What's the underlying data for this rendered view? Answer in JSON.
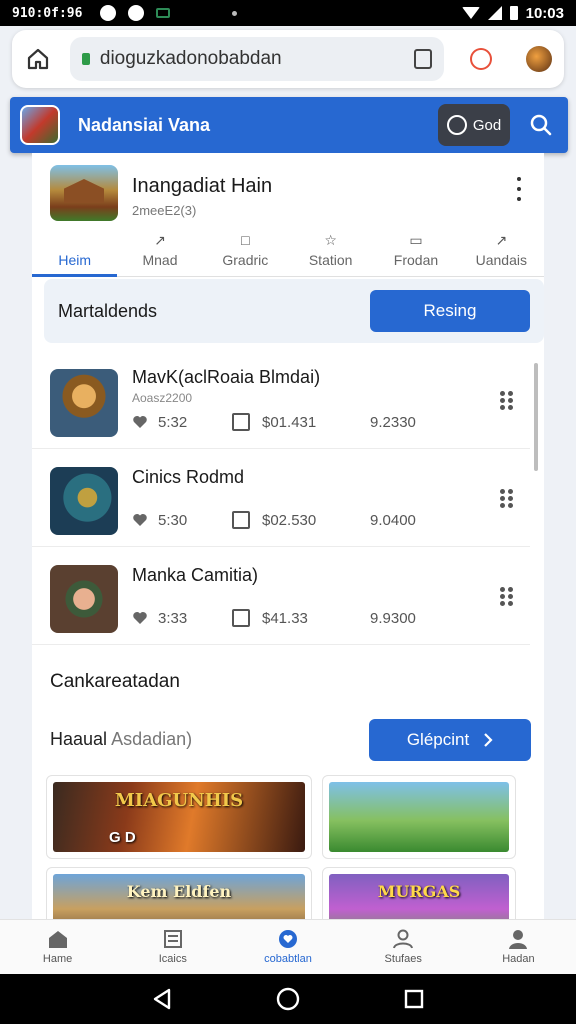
{
  "status_bar": {
    "time_left": "910:0f:96",
    "time_right": "10:03"
  },
  "browser": {
    "url": "dioguzkadonobabdan"
  },
  "app_bar": {
    "title": "Nadansiai Vana",
    "god_label": "God"
  },
  "game": {
    "title": "Inangadiat Hain",
    "subtitle": "2meeE2(3)",
    "tabs": [
      {
        "label": "Heim",
        "glyph": ""
      },
      {
        "label": "Mnad",
        "glyph": "↗"
      },
      {
        "label": "Gradric",
        "glyph": "□"
      },
      {
        "label": "Station",
        "glyph": "☆"
      },
      {
        "label": "Frodan",
        "glyph": "▭"
      },
      {
        "label": "Uandais",
        "glyph": "↗"
      }
    ]
  },
  "banner": {
    "label": "Martaldends",
    "button": "Resing"
  },
  "items": [
    {
      "title": "MavK(aclRoaia Blmdai)",
      "sub": "Aoasz2200",
      "likes": "5:32",
      "price": "$01.431",
      "value": "9.2330"
    },
    {
      "title": "Cinics Rodmd",
      "sub": "",
      "likes": "5:30",
      "price": "$02.530",
      "value": "9.0400"
    },
    {
      "title": "Manka Camitia)",
      "sub": "",
      "likes": "3:33",
      "price": "$41.33",
      "value": "9.9300"
    }
  ],
  "section": {
    "title": "Cankareatadan",
    "sub_label": "Haaual",
    "sub_label_muted": "Asdadian)",
    "button": "Glépcint"
  },
  "grid_cards": [
    {
      "title": "MIAGUNHIS",
      "tag": "G D"
    },
    {
      "title": "",
      "tag": ""
    },
    {
      "title": "Kem Eldfen",
      "tag": ""
    },
    {
      "title": "MURGAS",
      "tag": ""
    }
  ],
  "bottom_nav": [
    {
      "label": "Hame"
    },
    {
      "label": "Icaics"
    },
    {
      "label": "cobabtlan"
    },
    {
      "label": "Stufaes"
    },
    {
      "label": "Hadan"
    }
  ],
  "colors": {
    "accent": "#2768d1",
    "banner_bg": "#edf2f8",
    "heart_red": "#e8503a"
  }
}
